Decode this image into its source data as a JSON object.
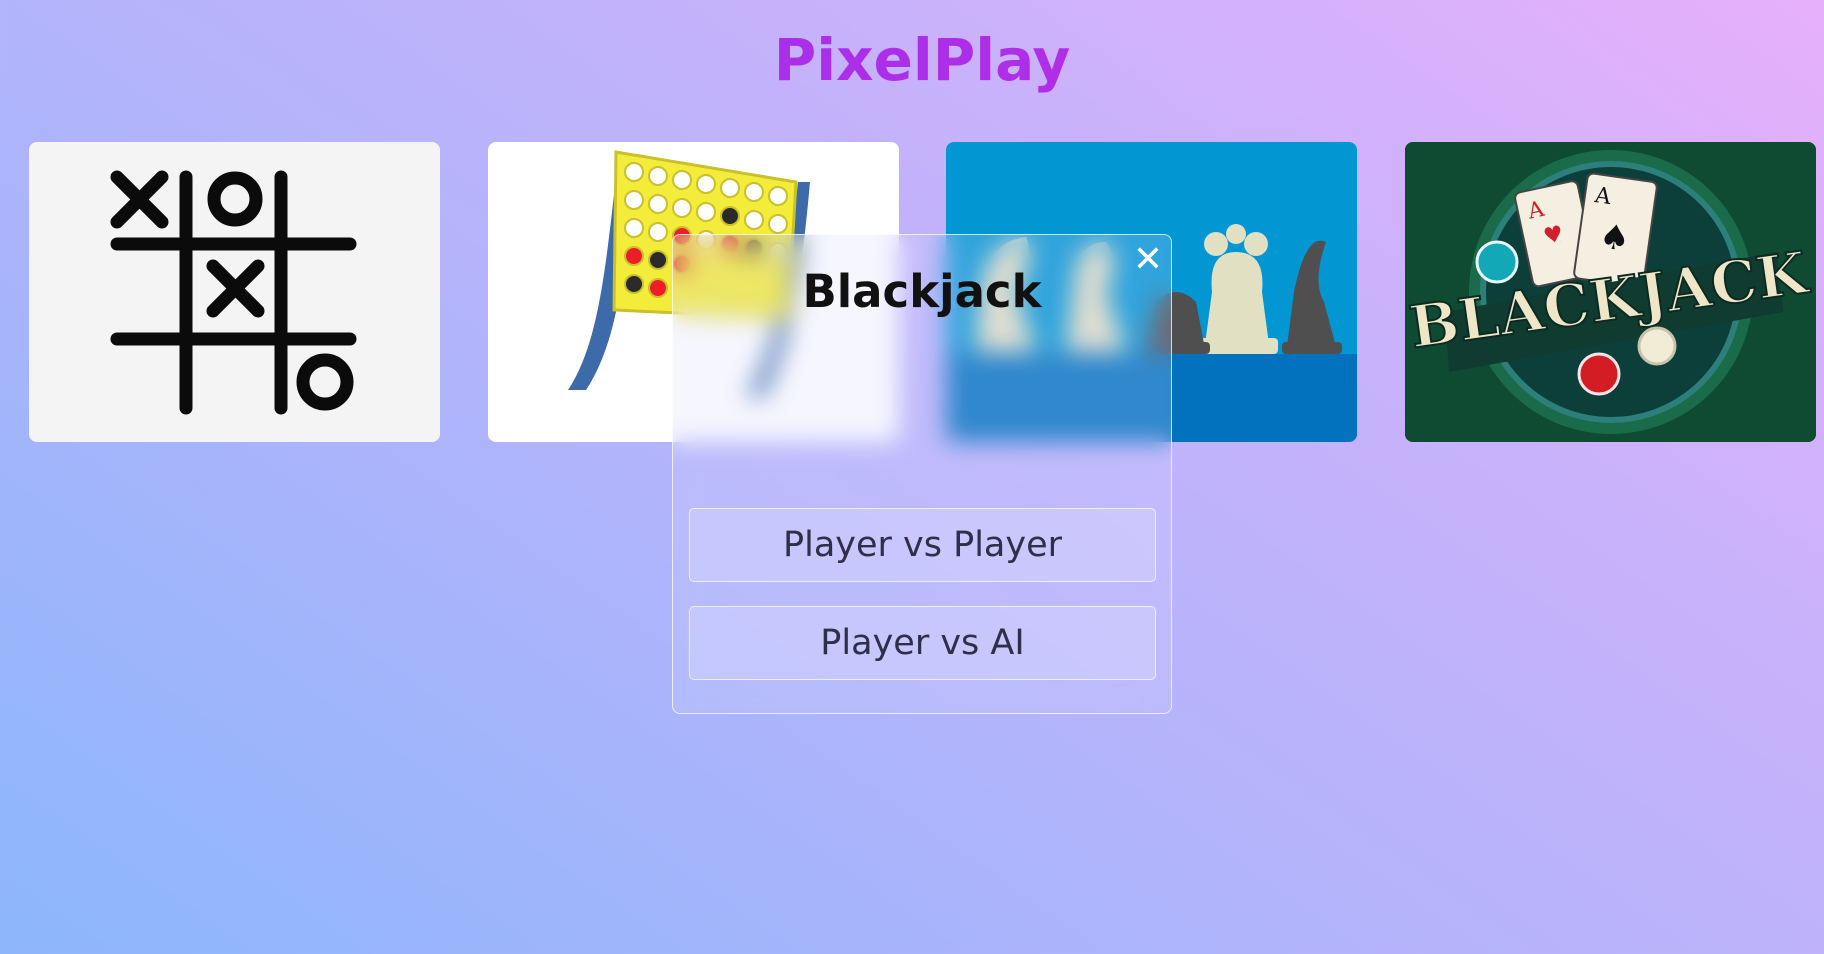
{
  "app": {
    "title": "PixelPlay"
  },
  "games": [
    {
      "name": "Tic Tac Toe",
      "icon": "tic-tac-toe-board-icon"
    },
    {
      "name": "Connect Four",
      "icon": "connect-four-board-icon"
    },
    {
      "name": "Chess",
      "icon": "chess-pieces-icon"
    },
    {
      "name": "Blackjack",
      "icon": "blackjack-logo-icon",
      "logo_text": "BLACKJACK"
    }
  ],
  "modal": {
    "title": "Blackjack",
    "close_label": "✕",
    "options": [
      "Player vs Player",
      "Player vs AI"
    ]
  },
  "colors": {
    "title_gradient": [
      "#9a30f0",
      "#c02de0"
    ],
    "background_gradient": [
      "#8cb6fb",
      "#e7b0fb"
    ],
    "card_tictactoe_bg": "#f4f4f4",
    "card_chess_bg": "#0296d3",
    "card_blackjack_bg": "#0f4a32"
  }
}
